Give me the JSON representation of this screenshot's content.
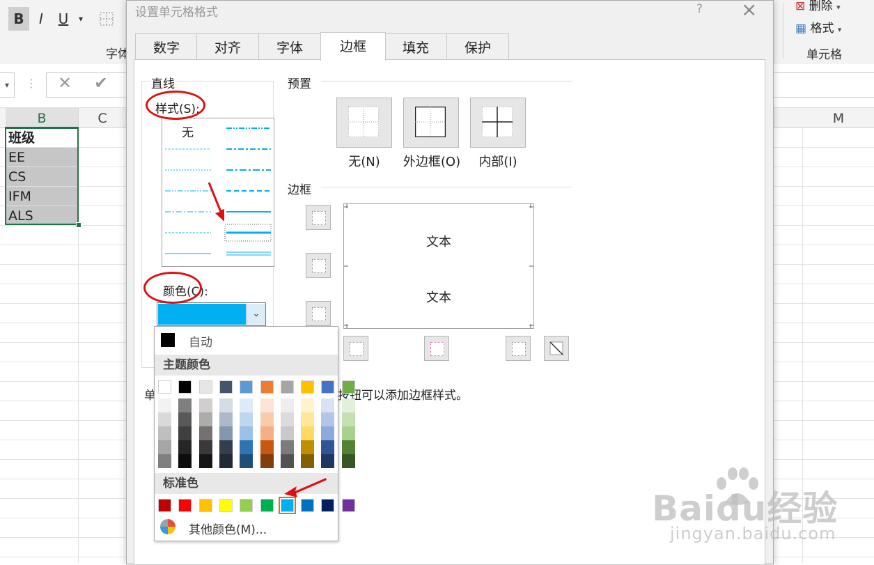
{
  "ribbon": {
    "font_group_caption": "字体",
    "cells_group_caption": "单元格",
    "delete_label": "删除",
    "format_label": "格式"
  },
  "sheet": {
    "columns": [
      "B",
      "C",
      "M"
    ],
    "cells": [
      "班级",
      "EE",
      "CS",
      "IFM",
      "ALS"
    ]
  },
  "dialog": {
    "title": "设置单元格格式",
    "help": "?",
    "tabs": [
      "数字",
      "对齐",
      "字体",
      "边框",
      "填充",
      "保护"
    ],
    "active_tab": "边框",
    "line_group": "直线",
    "style_label": "样式(S):",
    "style_none": "无",
    "color_label": "颜色(C):",
    "selected_color": "#00b0f0",
    "preset_group": "预置",
    "presets": [
      "无(N)",
      "外边框(O)",
      "内部(I)"
    ],
    "border_group": "边框",
    "preview_text": [
      "文本",
      "文本"
    ],
    "hint_start": "单",
    "hint_end": "按钮可以添加边框样式。"
  },
  "color_picker": {
    "auto_label": "自动",
    "theme_header": "主题颜色",
    "standard_header": "标准色",
    "more_label": "其他颜色(M)...",
    "theme_colors": [
      "#ffffff",
      "#000000",
      "#e7e6e6",
      "#44546a",
      "#5b9bd5",
      "#ed7d31",
      "#a5a5a5",
      "#ffc000",
      "#4472c4",
      "#70ad47"
    ],
    "theme_shades": [
      [
        "#f2f2f2",
        "#d9d9d9",
        "#bfbfbf",
        "#a6a6a6",
        "#808080"
      ],
      [
        "#7f7f7f",
        "#595959",
        "#404040",
        "#262626",
        "#0d0d0d"
      ],
      [
        "#d0cece",
        "#aeabab",
        "#757171",
        "#3a3838",
        "#171616"
      ],
      [
        "#d6dce4",
        "#adb9ca",
        "#8497b0",
        "#333f4f",
        "#222a35"
      ],
      [
        "#ddebf7",
        "#bdd7ee",
        "#9bc2e6",
        "#2f75b5",
        "#1f4e78"
      ],
      [
        "#fce4d6",
        "#f8cbad",
        "#f4b084",
        "#c65911",
        "#833c0c"
      ],
      [
        "#ededed",
        "#dbdbdb",
        "#c9c9c9",
        "#7b7b7b",
        "#525252"
      ],
      [
        "#fff2cc",
        "#ffe699",
        "#ffd966",
        "#bf8f00",
        "#806000"
      ],
      [
        "#d9e1f2",
        "#b4c6e7",
        "#8ea9db",
        "#305496",
        "#203764"
      ],
      [
        "#e2efda",
        "#c6e0b4",
        "#a9d08e",
        "#548235",
        "#375623"
      ]
    ],
    "standard_colors": [
      "#c00000",
      "#ff0000",
      "#ffc000",
      "#ffff00",
      "#92d050",
      "#00b050",
      "#00b0f0",
      "#0070c0",
      "#002060",
      "#7030a0"
    ],
    "selected_standard_index": 6
  },
  "watermark": {
    "brand": "Baidu经验",
    "url": "jingyan.baidu.com"
  },
  "colors": {
    "accent_green": "#217346",
    "annotation_red": "#e01010",
    "line_cyan": "#00b0f0"
  }
}
